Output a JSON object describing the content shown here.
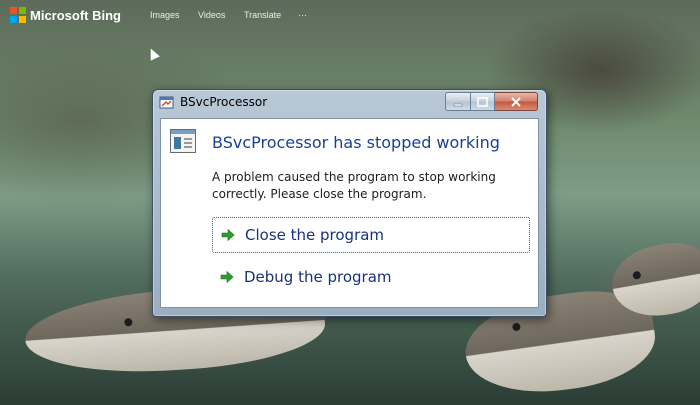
{
  "bing": {
    "title": "Microsoft Bing",
    "nav": [
      "Images",
      "Videos",
      "Translate",
      "···"
    ]
  },
  "dialog": {
    "title": "BSvcProcessor",
    "main_instruction": "BSvcProcessor has stopped working",
    "message": "A problem caused the program to stop working correctly. Please close the program.",
    "commands": [
      {
        "label": "Close the program",
        "focused": true
      },
      {
        "label": "Debug the program",
        "focused": false
      }
    ]
  },
  "colors": {
    "instruction_text": "#1b3f97",
    "command_arrow": "#2d9c2d",
    "bing_logo": [
      "#f25022",
      "#7fba00",
      "#00a4ef",
      "#ffb900"
    ]
  }
}
